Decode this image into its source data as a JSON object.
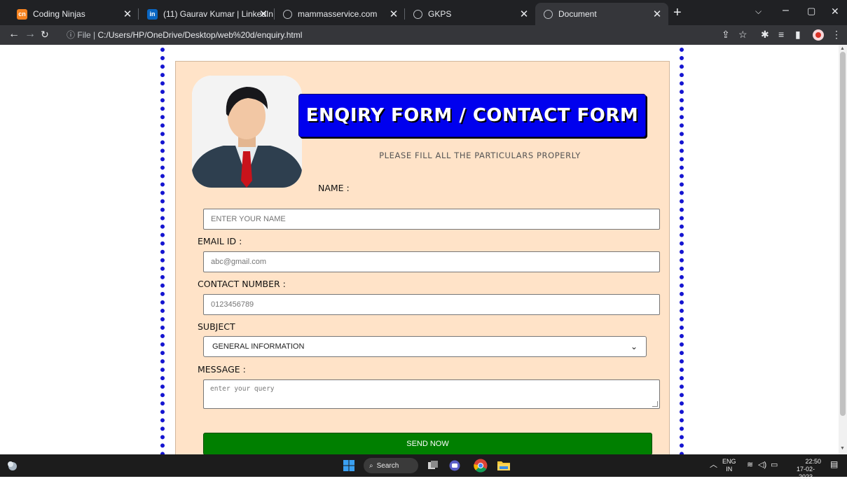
{
  "browser": {
    "tabs": [
      {
        "title": "Coding Ninjas",
        "favicon_text": "cn",
        "favicon_color": "#f5821f"
      },
      {
        "title": "(11) Gaurav Kumar | LinkedIn",
        "favicon_text": "in",
        "favicon_color": "#0a66c2"
      },
      {
        "title": "mammasservice.com",
        "favicon_text": "",
        "favicon_color": "#9aa0a6"
      },
      {
        "title": "GKPS",
        "favicon_text": "",
        "favicon_color": "#9aa0a6"
      },
      {
        "title": "Document",
        "favicon_text": "",
        "favicon_color": "#9aa0a6",
        "active": true
      }
    ],
    "address": {
      "prefix": "File",
      "url": "C:/Users/HP/OneDrive/Desktop/web%20d/enquiry.html"
    }
  },
  "form": {
    "heading": "ENQIRY FORM / CONTACT FORM",
    "subtitle": "PLEASE FILL ALL THE PARTICULARS PROPERLY",
    "name_label": "NAME :",
    "name_placeholder": "ENTER YOUR NAME",
    "email_label": "EMAIL ID :",
    "email_placeholder": "abc@gmail.com",
    "contact_label": "CONTACT NUMBER :",
    "contact_placeholder": "0123456789",
    "subject_label": "SUBJECT",
    "subject_selected": "GENERAL INFORMATION",
    "message_label": "MESSAGE :",
    "message_placeholder": "enter your query",
    "submit_label": "SEND NOW"
  },
  "colors": {
    "form_background": "#ffe3c8",
    "banner": "#0000ee",
    "dotted_border": "#1515d1",
    "submit_button": "#007f00"
  },
  "taskbar": {
    "search_label": "Search",
    "lang_top": "ENG",
    "lang_bottom": "IN",
    "time": "22:50",
    "date": "17-02-2023"
  }
}
